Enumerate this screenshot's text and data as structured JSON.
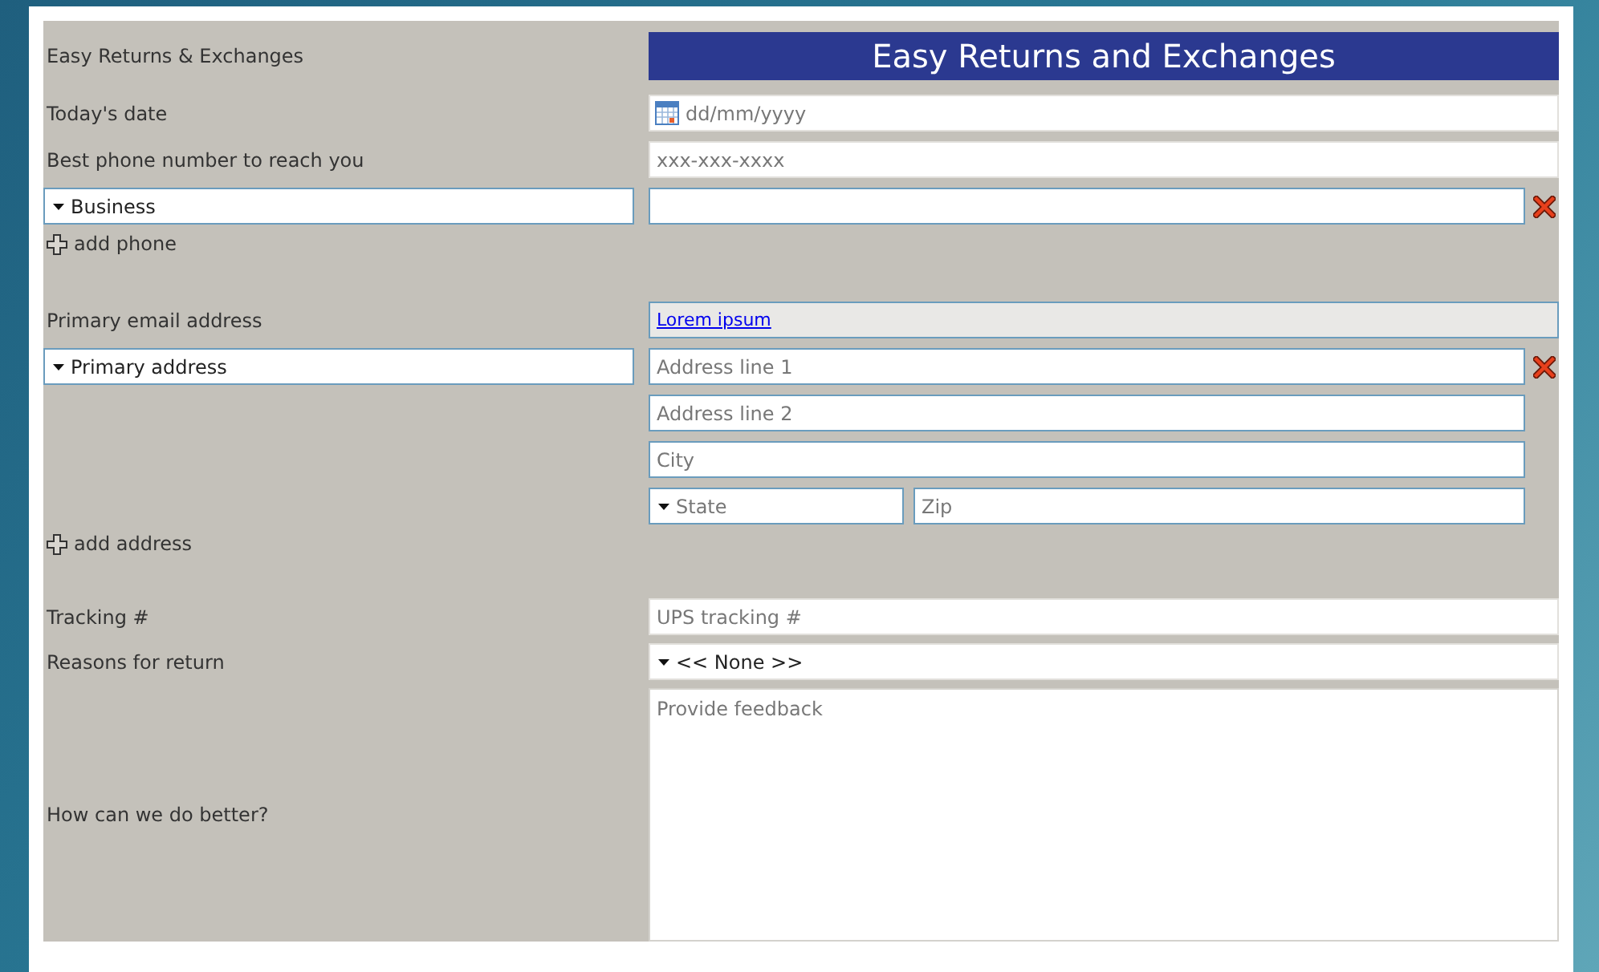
{
  "heading": {
    "label": "Easy Returns & Exchanges",
    "title": "Easy Returns and Exchanges"
  },
  "date": {
    "label": "Today's date",
    "placeholder": "dd/mm/yyyy"
  },
  "phone": {
    "label": "Best phone number to reach you",
    "placeholder": "xxx-xxx-xxxx",
    "type_select": "Business",
    "add_link": "add phone"
  },
  "email": {
    "label": "Primary email address",
    "link": "Lorem ipsum"
  },
  "address": {
    "type_select": "Primary address",
    "line1_placeholder": "Address line 1",
    "line2_placeholder": "Address line 2",
    "city_placeholder": "City",
    "state_select": "State",
    "zip_placeholder": "Zip",
    "add_link": "add address"
  },
  "tracking": {
    "label": "Tracking #",
    "placeholder": "UPS tracking #"
  },
  "reason": {
    "label": "Reasons for return",
    "select": "<< None >>"
  },
  "feedback": {
    "label": "How can we do better?",
    "placeholder": "Provide feedback"
  }
}
